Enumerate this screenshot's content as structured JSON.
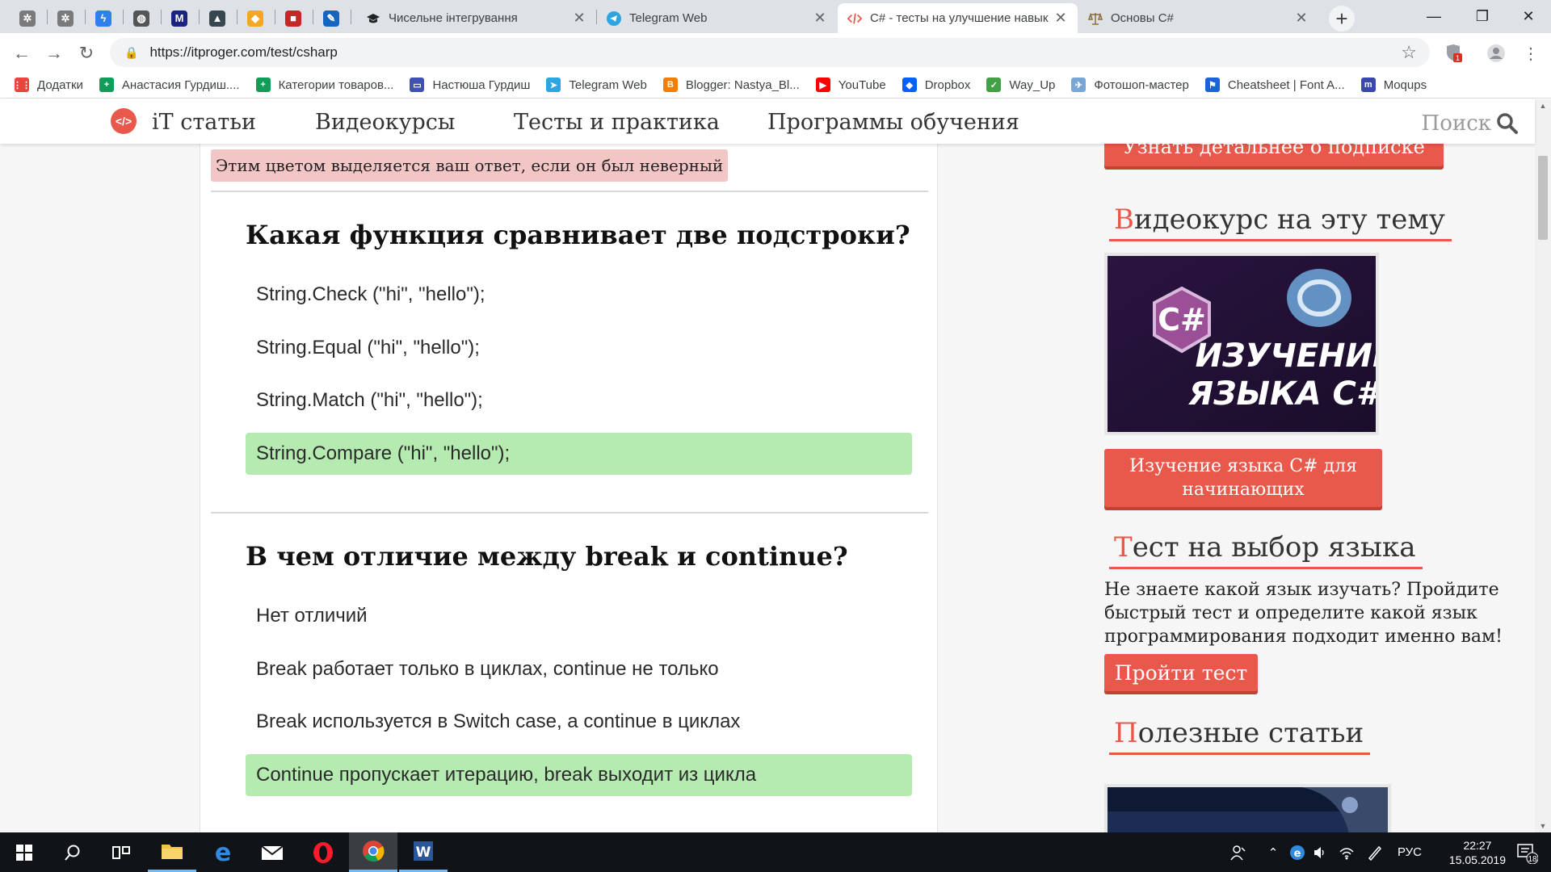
{
  "browser": {
    "pinned_tabs": [
      {
        "icon": "settings-gear-icon",
        "color": "#7a7a7a"
      },
      {
        "icon": "settings-gear-icon",
        "color": "#7a7a7a"
      },
      {
        "icon": "lightning-icon",
        "color": "#2f80ed"
      },
      {
        "icon": "globe-icon",
        "color": "#555555"
      },
      {
        "icon": "m-logo-icon",
        "color": "#1a237e"
      },
      {
        "icon": "graduation-cap-icon",
        "color": "#37474f"
      },
      {
        "icon": "lightbulb-icon",
        "color": "#f5a623"
      },
      {
        "icon": "red-square-icon",
        "color": "#c62828"
      },
      {
        "icon": "pencil-icon",
        "color": "#1565c0"
      }
    ],
    "tabs": [
      {
        "title": "Чисельне інтегрування",
        "icon": "graduation-cap-icon"
      },
      {
        "title": "Telegram Web",
        "icon": "telegram-icon"
      },
      {
        "title": "C# - тесты на улучшение навык",
        "icon": "code-icon"
      },
      {
        "title": "Основы C#",
        "icon": "scales-icon"
      }
    ],
    "url": "https://itproger.com/test/csharp",
    "extension_badge": "1",
    "bookmarks": [
      {
        "label": "Додатки",
        "icon": "apps-grid-icon",
        "color": "#e8453c"
      },
      {
        "label": "Анастасия Гурдиш....",
        "icon": "plus-sheet-icon",
        "color": "#0f9d58"
      },
      {
        "label": "Категории товаров...",
        "icon": "plus-sheet-icon",
        "color": "#0f9d58"
      },
      {
        "label": "Настюша Гурдиш",
        "icon": "chat-bubble-icon",
        "color": "#3f51b5"
      },
      {
        "label": "Telegram Web",
        "icon": "telegram-icon",
        "color": "#2ca5e0"
      },
      {
        "label": "Blogger: Nastya_Bl...",
        "icon": "blogger-icon",
        "color": "#f57d00"
      },
      {
        "label": "YouTube",
        "icon": "youtube-icon",
        "color": "#ff0000"
      },
      {
        "label": "Dropbox",
        "icon": "dropbox-icon",
        "color": "#0061ff"
      },
      {
        "label": "Way_Up",
        "icon": "leaf-icon",
        "color": "#43a047"
      },
      {
        "label": "Фотошоп-мастер",
        "icon": "bird-icon",
        "color": "#7aa6d6"
      },
      {
        "label": "Cheatsheet | Font A...",
        "icon": "flag-icon",
        "color": "#1e63d6"
      },
      {
        "label": "Moqups",
        "icon": "m-logo-icon",
        "color": "#3949ab"
      }
    ]
  },
  "site": {
    "logo_glyph": "</>",
    "nav": [
      "iT статьи",
      "Видеокурсы",
      "Тесты и практика",
      "Программы обучения"
    ],
    "search_label": "Поиск"
  },
  "quiz": {
    "legend_wrong": "Этим цветом выделяется ваш ответ, если он был неверный",
    "questions": [
      {
        "question": "Какая функция сравнивает две подстроки?",
        "answers": [
          {
            "text": "String.Check (\"hi\", \"hello\");",
            "correct": false
          },
          {
            "text": "String.Equal (\"hi\", \"hello\");",
            "correct": false
          },
          {
            "text": "String.Match (\"hi\", \"hello\");",
            "correct": false
          },
          {
            "text": "String.Compare (\"hi\", \"hello\");",
            "correct": true
          }
        ]
      },
      {
        "question": "В чем отличие между break и continue?",
        "answers": [
          {
            "text": "Нет отличий",
            "correct": false
          },
          {
            "text": "Break работает только в циклах, continue не только",
            "correct": false
          },
          {
            "text": "Break используется в Switch case, а continue в циклах",
            "correct": false
          },
          {
            "text": "Continue пропускает итерацию, break выходит из цикла",
            "correct": true
          }
        ]
      }
    ]
  },
  "sidebar": {
    "subscription_button": "Узнать детальнее о подписке",
    "video_heading": {
      "first": "В",
      "rest": "идеокурс на эту тему"
    },
    "course_image_text": {
      "line1": "ИЗУЧЕНИЕ",
      "line2": "ЯЗЫКА C#"
    },
    "course_button": "Изучение языка C# для начинающих",
    "test_heading": {
      "first": "Т",
      "rest": "ест на выбор языка"
    },
    "test_text": "Не знаете какой язык изучать? Пройдите быстрый тест и определите какой язык программирования подходит именно вам!",
    "test_button": "Пройти тест",
    "articles_heading": {
      "first": "П",
      "rest": "олезные статьи"
    }
  },
  "taskbar": {
    "language": "РУС",
    "time": "22:27",
    "date": "15.05.2019",
    "notifications": "18"
  }
}
